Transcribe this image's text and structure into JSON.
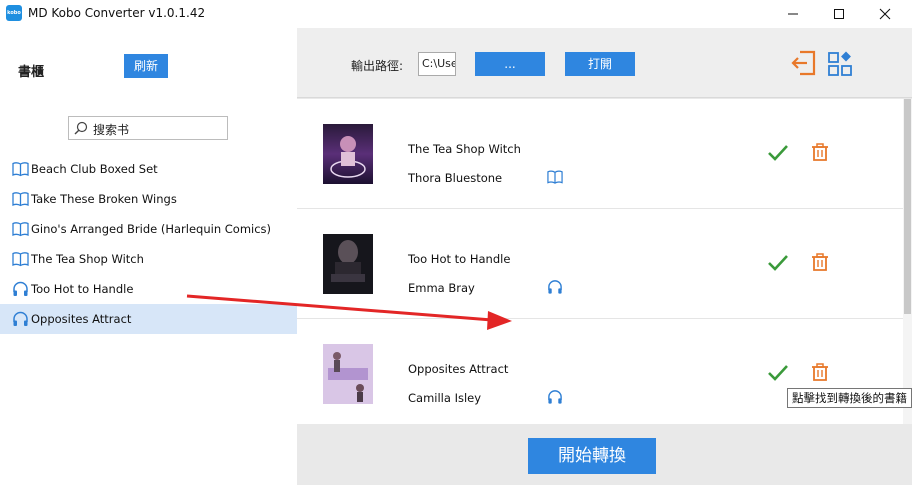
{
  "window": {
    "app_icon_text": "kobo",
    "title": "MD Kobo Converter v1.0.1.42"
  },
  "sidebar": {
    "shelf_title": "書櫃",
    "refresh_label": "刷新",
    "search_placeholder": "搜索书",
    "books": [
      {
        "label": "Beach Club Boxed Set",
        "icon": "book-icon"
      },
      {
        "label": "Take These Broken Wings",
        "icon": "book-icon"
      },
      {
        "label": "Gino's Arranged Bride (Harlequin Comics)",
        "icon": "book-icon"
      },
      {
        "label": "The Tea Shop Witch",
        "icon": "book-icon"
      },
      {
        "label": "Too Hot to Handle",
        "icon": "headphones-icon"
      },
      {
        "label": "Opposites Attract",
        "icon": "headphones-icon",
        "selected": true
      }
    ]
  },
  "toolbar": {
    "output_path_label": "輸出路徑:",
    "output_path_value": "C:\\Use",
    "browse_label": "...",
    "open_label": "打開"
  },
  "queue": [
    {
      "title": "The Tea Shop Witch",
      "author": "Thora Bluestone",
      "type": "book-icon",
      "status": "check-icon"
    },
    {
      "title": "Too Hot to Handle",
      "author": "Emma Bray",
      "type": "headphones-icon",
      "status": "check-icon"
    },
    {
      "title": "Opposites Attract",
      "author": "Camilla Isley",
      "type": "headphones-icon",
      "status": "check-icon"
    }
  ],
  "start_label": "開始轉換",
  "tooltip": "點擊找到轉換後的書籍",
  "colors": {
    "accent": "#2f86e0",
    "success": "#3a9a3a",
    "danger": "#e8782a",
    "selected_row": "#d7e6f8",
    "arrow": "#e32626"
  }
}
